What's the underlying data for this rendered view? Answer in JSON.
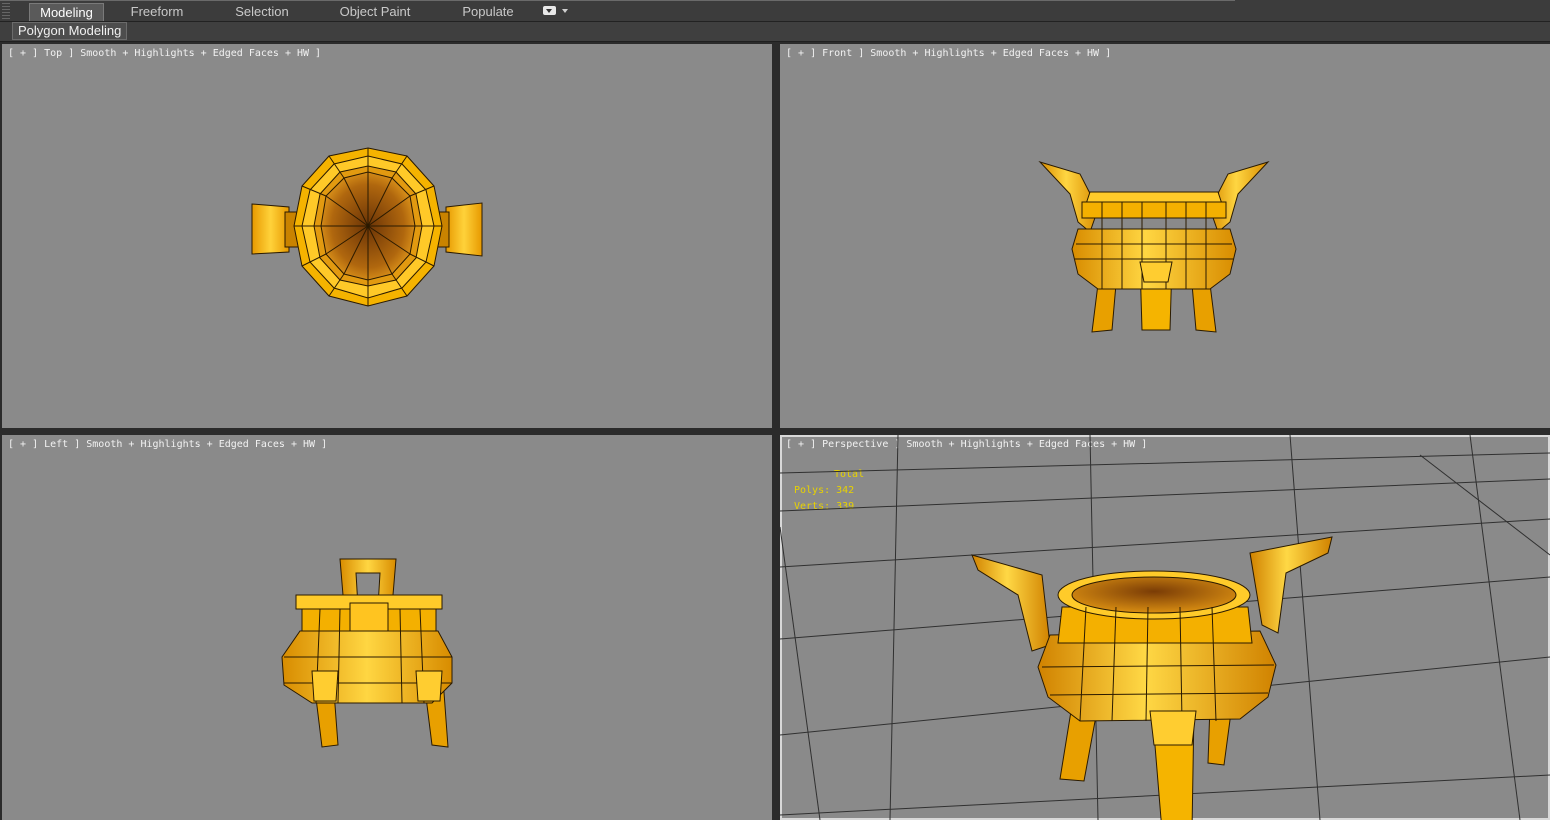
{
  "ribbon": {
    "tabs": [
      {
        "label": "Modeling",
        "active": true
      },
      {
        "label": "Freeform",
        "active": false
      },
      {
        "label": "Selection",
        "active": false
      },
      {
        "label": "Object Paint",
        "active": false
      },
      {
        "label": "Populate",
        "active": false
      }
    ],
    "panel_tab": "Polygon Modeling"
  },
  "viewports": {
    "top": {
      "label": "[ + ] Top ] Smooth + Highlights + Edged Faces + HW ]"
    },
    "front": {
      "label": "[ + ] Front ] Smooth + Highlights + Edged Faces + HW ]"
    },
    "left": {
      "label": "[ + ] Left ] Smooth + Highlights + Edged Faces + HW ]"
    },
    "perspective": {
      "label": "[ + ] Perspective ] Smooth + Highlights + Edged Faces + HW ]",
      "stats": {
        "title": "Total",
        "polys": "Polys: 342",
        "verts": "Verts: 339"
      }
    }
  },
  "colors": {
    "viewport_bg": "#8a8a8a",
    "gold_light": "#ffd23a",
    "gold_mid": "#f0a800",
    "gold_dark": "#b86e00",
    "stats_text": "#e8d200"
  }
}
